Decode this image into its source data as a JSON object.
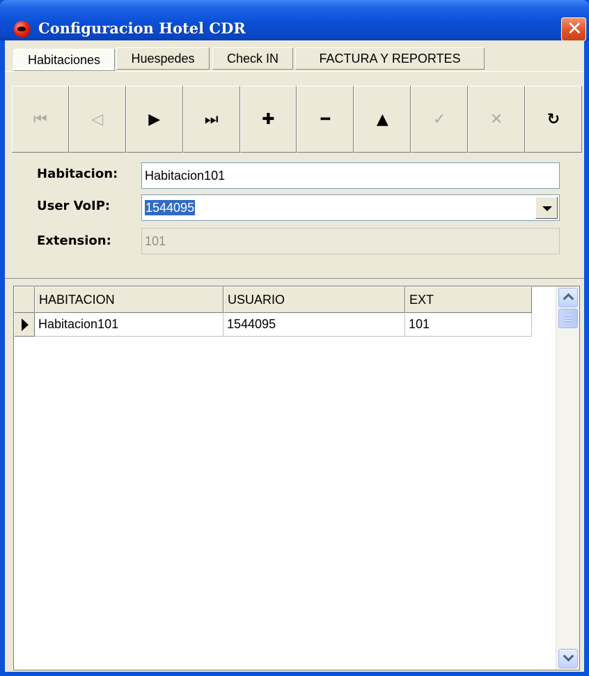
{
  "window": {
    "title": "Configuracion Hotel CDR",
    "close_glyph": "✕",
    "icon": "app-red-icon",
    "accent_color": "#0a52d8"
  },
  "tabs": [
    {
      "label": "Habitaciones",
      "active": true
    },
    {
      "label": "Huespedes",
      "active": false
    },
    {
      "label": "Check IN",
      "active": false
    },
    {
      "label": "FACTURA Y REPORTES",
      "active": false
    }
  ],
  "navigator": {
    "buttons": [
      {
        "name": "first",
        "glyph": "⏮",
        "enabled": false
      },
      {
        "name": "prior",
        "glyph": "◁",
        "enabled": false
      },
      {
        "name": "next",
        "glyph": "▶",
        "enabled": true
      },
      {
        "name": "last",
        "glyph": "⏭",
        "enabled": true
      },
      {
        "name": "insert",
        "glyph": "✚",
        "enabled": true
      },
      {
        "name": "delete",
        "glyph": "━",
        "enabled": true
      },
      {
        "name": "edit",
        "glyph": "▲",
        "enabled": true
      },
      {
        "name": "post",
        "glyph": "✓",
        "enabled": false
      },
      {
        "name": "cancel",
        "glyph": "✕",
        "enabled": false
      },
      {
        "name": "refresh",
        "glyph": "↻",
        "enabled": true
      }
    ]
  },
  "form": {
    "habitacion_label": "Habitacion:",
    "habitacion_value": "Habitacion101",
    "user_voip_label": "User VoIP:",
    "user_voip_value": "1544095",
    "extension_label": "Extension:",
    "extension_value": "101"
  },
  "grid": {
    "columns": [
      "HABITACION",
      "USUARIO",
      "EXT"
    ],
    "rows": [
      [
        "Habitacion101",
        "1544095",
        "101"
      ]
    ]
  }
}
